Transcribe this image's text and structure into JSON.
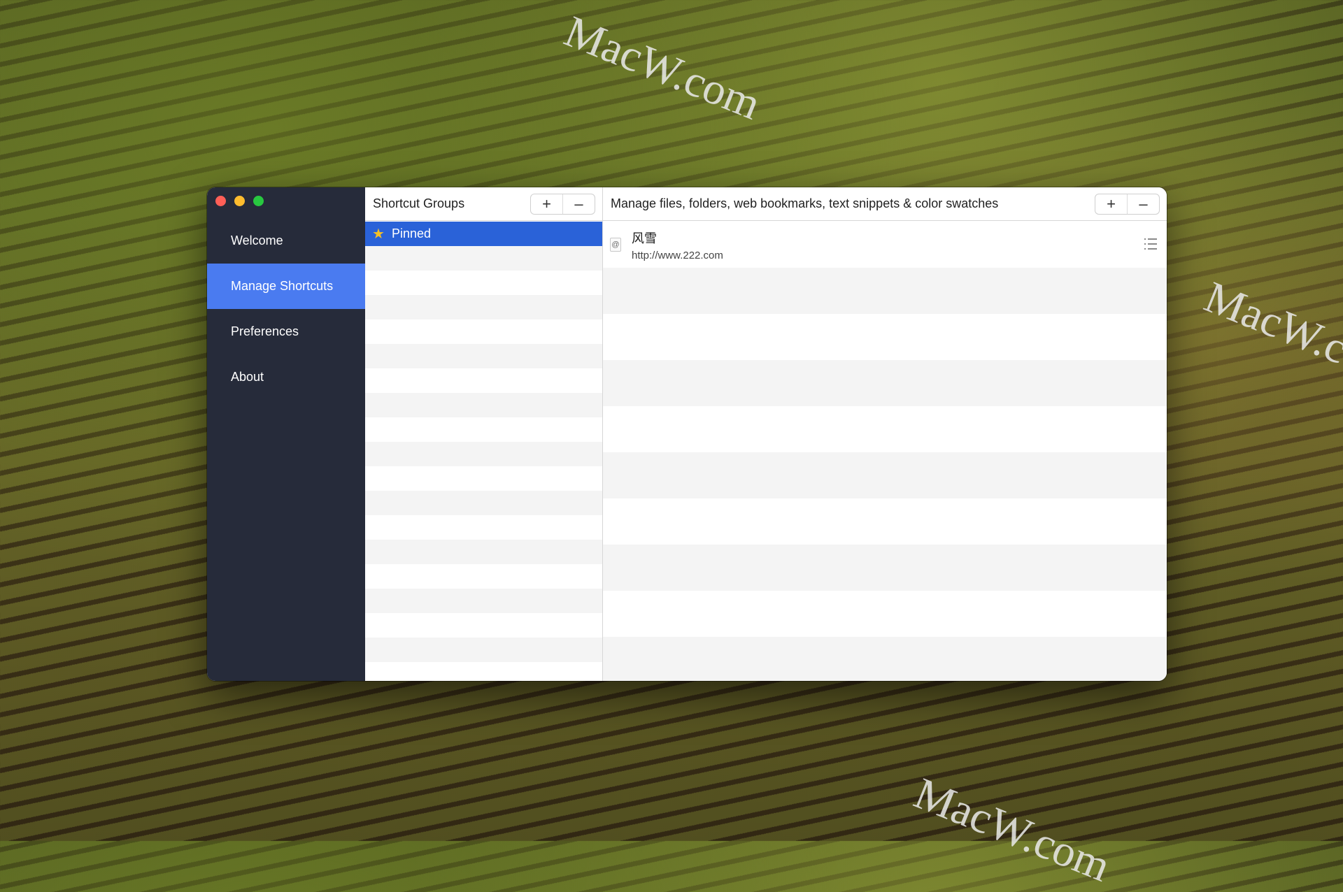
{
  "window": {
    "sidebar": {
      "items": [
        {
          "label": "Welcome",
          "active": false
        },
        {
          "label": "Manage Shortcuts",
          "active": true
        },
        {
          "label": "Preferences",
          "active": false
        },
        {
          "label": "About",
          "active": false
        }
      ]
    },
    "groups_panel": {
      "title": "Shortcut Groups",
      "add_label": "+",
      "remove_label": "–",
      "items": [
        {
          "label": "Pinned",
          "icon": "star-icon",
          "selected": true
        }
      ]
    },
    "shortcuts_panel": {
      "title": "Manage files, folders, web bookmarks, text snippets & color swatches",
      "add_label": "+",
      "remove_label": "–",
      "items": [
        {
          "name": "风雪",
          "url": "http://www.222.com",
          "icon": "bookmark-icon"
        }
      ]
    }
  },
  "watermark": "MacW.com",
  "colors": {
    "sidebar_bg": "#262b3a",
    "sidebar_active": "#4a7bf0",
    "selection": "#2a62d8"
  }
}
